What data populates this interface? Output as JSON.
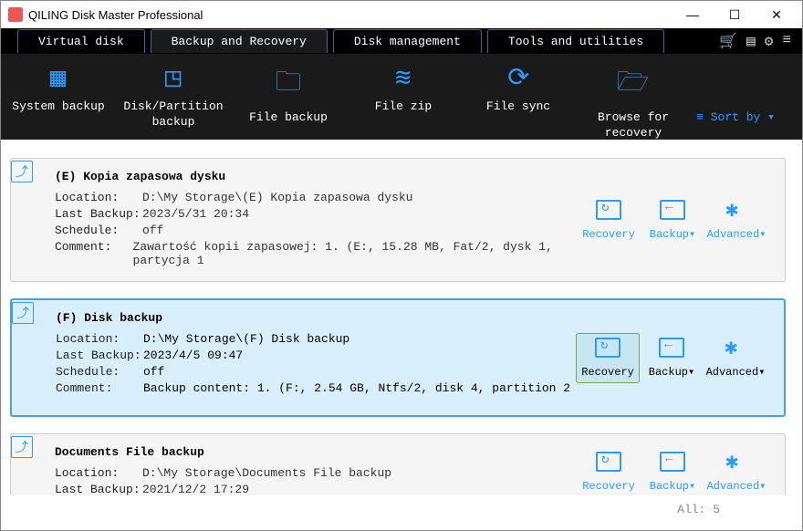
{
  "window": {
    "title": "QILING Disk Master Professional"
  },
  "tabs": [
    {
      "label": "Virtual disk"
    },
    {
      "label": "Backup and Recovery",
      "active": true
    },
    {
      "label": "Disk management"
    },
    {
      "label": "Tools and utilities"
    }
  ],
  "tools": [
    {
      "label": "System backup"
    },
    {
      "label": "Disk/Partition\nbackup"
    },
    {
      "label": "File backup"
    },
    {
      "label": "File zip"
    },
    {
      "label": "File sync"
    },
    {
      "label": "Browse for\nrecovery"
    }
  ],
  "sort_label": "Sort by ▾",
  "cards": [
    {
      "title": "(E) Kopia zapasowa dysku",
      "rows": {
        "location_k": "Location:",
        "location_v": "D:\\My Storage\\(E) Kopia zapasowa dysku",
        "last_k": "Last Backup:",
        "last_v": "2023/5/31 20:34",
        "sched_k": "Schedule:",
        "sched_v": "off",
        "comment_k": "Comment:",
        "comment_v": "Zawartość kopii zapasowej: 1. (E:, 15.28 MB, Fat/2, dysk 1, partycja 1"
      },
      "selected": false
    },
    {
      "title": "(F) Disk backup",
      "rows": {
        "location_k": "Location:",
        "location_v": "D:\\My Storage\\(F) Disk backup",
        "last_k": "Last Backup:",
        "last_v": "2023/4/5 09:47",
        "sched_k": "Schedule:",
        "sched_v": "off",
        "comment_k": "Comment:",
        "comment_v": "Backup content: 1. (F:, 2.54 GB, Ntfs/2, disk 4, partition 2"
      },
      "selected": true
    },
    {
      "title": "Documents File backup",
      "rows": {
        "location_k": "Location:",
        "location_v": "D:\\My Storage\\Documents File backup",
        "last_k": "Last Backup:",
        "last_v": "2021/12/2 17:29"
      },
      "selected": false
    }
  ],
  "action_labels": {
    "recovery": "Recovery",
    "backup": "Backup▾",
    "advanced": "Advanced▾"
  },
  "status": {
    "all_label": "All:",
    "all_count": "5"
  }
}
